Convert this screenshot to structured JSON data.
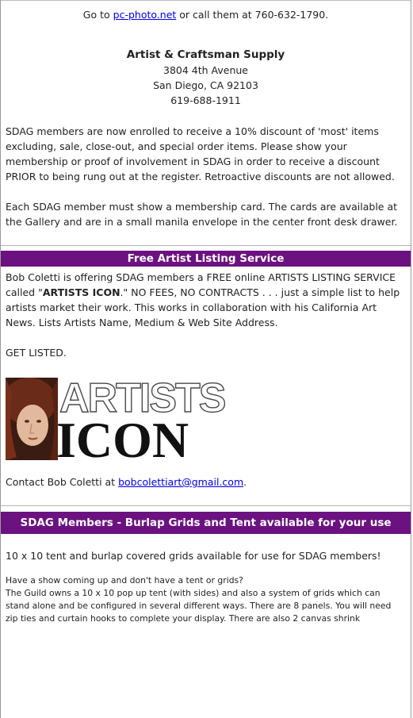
{
  "intro": {
    "prefix": "Go to ",
    "link": "pc-photo.net",
    "suffix": " or call them at 760-632-1790."
  },
  "supply": {
    "name": "Artist & Craftsman Supply",
    "street": "3804 4th Avenue",
    "city": "San Diego, CA 92103",
    "phone": "619-688-1911"
  },
  "discount_text": "SDAG members are now enrolled to receive a 10% discount of 'most' items excluding, sale, close-out, and special order items. Please show your membership or proof of involvement in SDAG in order to receive a discount PRIOR to being rung out at the register. Retroactive discounts are not allowed.",
  "card_text": "Each SDAG member must show a membership card.  The cards are available at the Gallery and are in a small manila envelope in the center front desk drawer.",
  "listing": {
    "heading": "Free Artist Listing Service",
    "para_a": "Bob Coletti is offering SDAG members a FREE online ARTISTS LISTING SERVICE called \"",
    "para_bold": "ARTISTS ICON",
    "para_b": ".\"  NO FEES, NO CONTRACTS . . . just a simple list to help artists market their work.  This works in collaboration with his California Art News.  Lists Artists Name, Medium & Web Site Address.",
    "get_listed": "GET LISTED.",
    "logo_top": "ARTISTS",
    "logo_bottom": "ICON",
    "contact_prefix": "Contact Bob Coletti at ",
    "contact_email": "bobcolettiart@gmail.com",
    "contact_suffix": "."
  },
  "grids": {
    "heading": "SDAG Members - Burlap Grids and Tent available for your use",
    "lead": "10 x 10 tent and burlap covered grids available for use for SDAG members!",
    "detail_1": "Have a show coming up and don't have a tent or grids?",
    "detail_2": "The Guild owns a 10 x 10 pop up tent (with sides) and also a system of grids which can stand alone and be configured in several different ways.  There are 8 panels.  You will need zip ties and curtain hooks to complete your display.  There are also 2 canvas shrink"
  },
  "colors": {
    "header_bg": "#6b1280",
    "link": "#0000ee"
  }
}
